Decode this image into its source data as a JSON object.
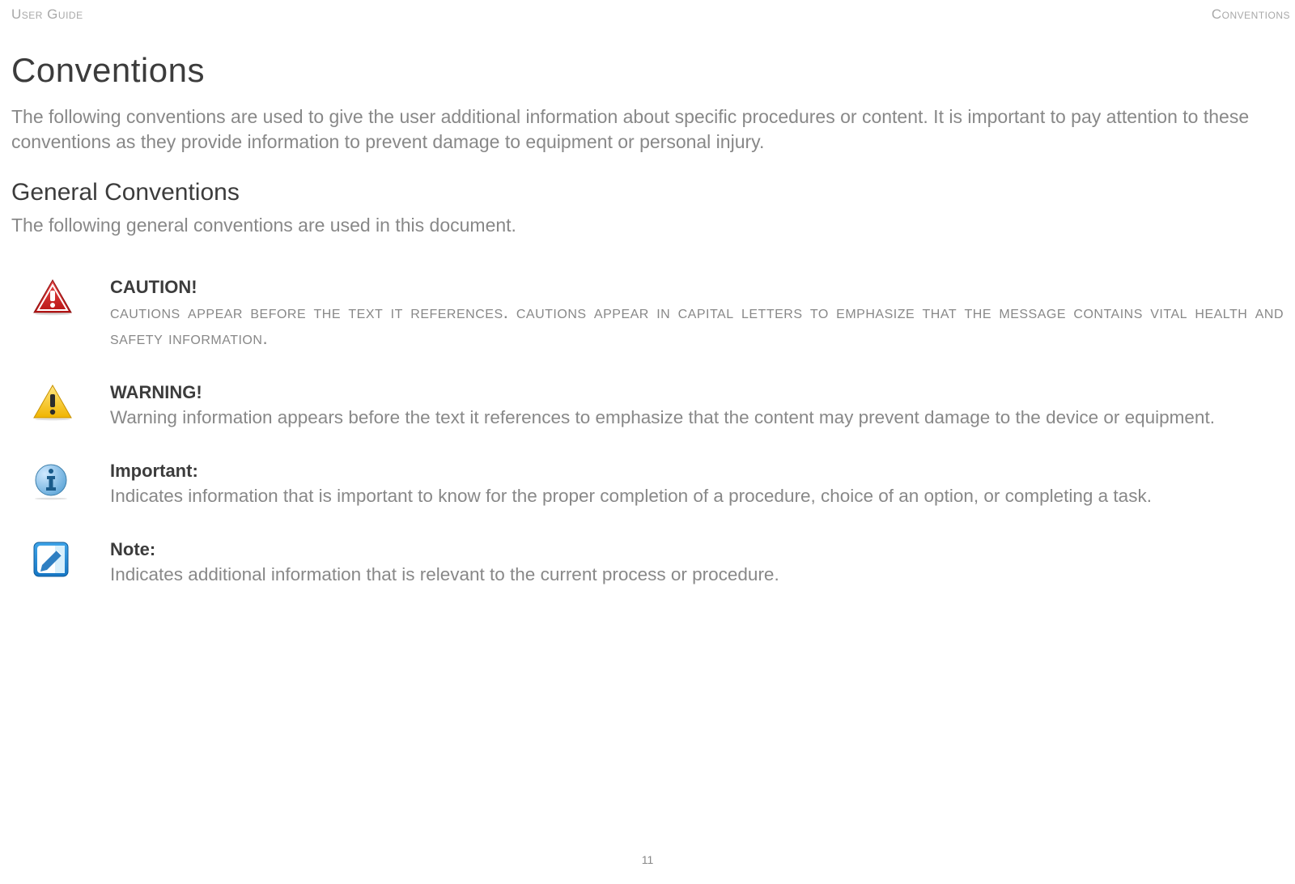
{
  "header": {
    "left": "User Guide",
    "right": "Conventions"
  },
  "title": "Conventions",
  "intro": "The following conventions are used to give the user additional information about specific procedures or content. It is important to pay attention to these conventions as they provide information to prevent damage to equipment or personal injury.",
  "subtitle": "General Conventions",
  "subintro": "The following general conventions are used in this document.",
  "conventions": [
    {
      "heading": "CAUTION!",
      "text": "cautions appear before the text it references. cautions appear in capital letters to emphasize that the message contains vital health and safety information."
    },
    {
      "heading": "WARNING!",
      "text": "Warning information appears before the text it references to emphasize that the content may prevent damage to the device or equipment."
    },
    {
      "heading": "Important:",
      "text": "Indicates information that is important to know for the proper completion of a procedure, choice of an option, or completing a task."
    },
    {
      "heading": "Note:",
      "text": "Indicates additional information that is relevant to the current process or procedure."
    }
  ],
  "page_number": "11"
}
